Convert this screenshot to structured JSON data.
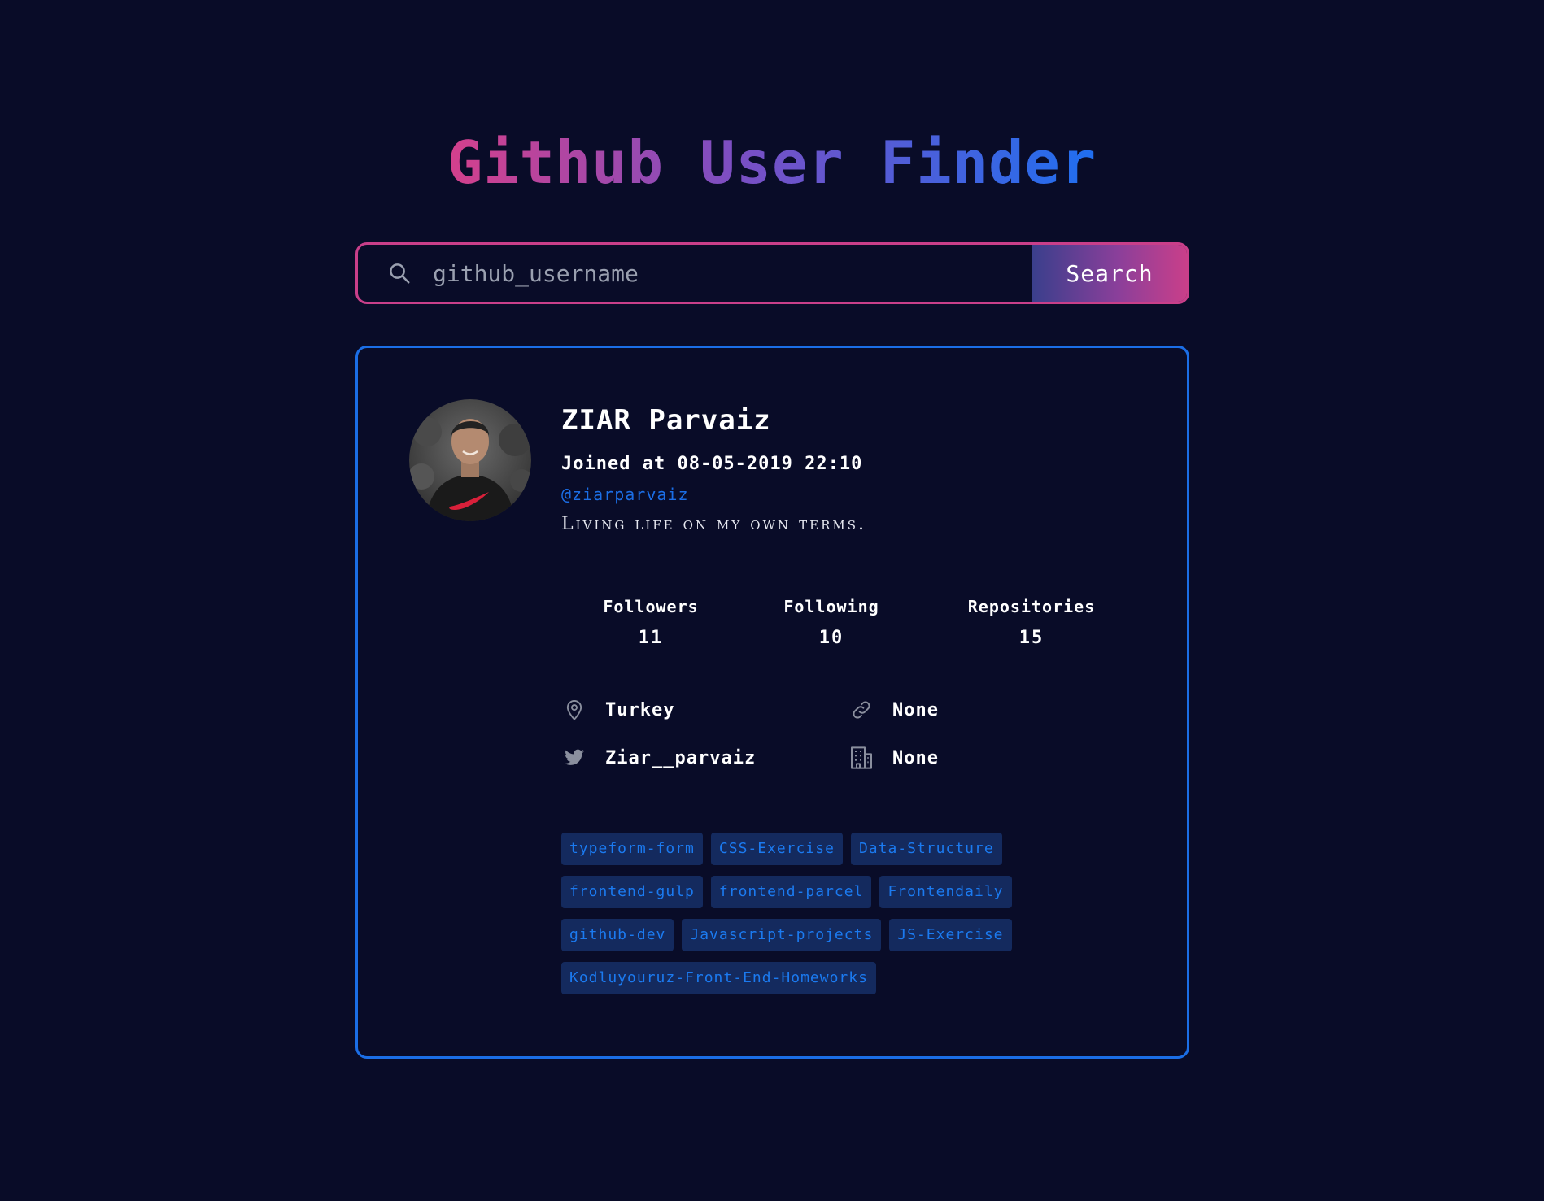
{
  "header": {
    "title": "Github User Finder"
  },
  "search": {
    "placeholder": "github_username",
    "value": "",
    "button_label": "Search"
  },
  "profile": {
    "name": "ZIAR Parvaiz",
    "joined": "Joined at 08-05-2019 22:10",
    "login": "@ziarparvaiz",
    "bio": "Living life on my own terms."
  },
  "stats": {
    "followers_label": "Followers",
    "followers_value": "11",
    "following_label": "Following",
    "following_value": "10",
    "repositories_label": "Repositories",
    "repositories_value": "15"
  },
  "details": {
    "location": "Turkey",
    "blog": "None",
    "twitter": "Ziar__parvaiz",
    "company": "None"
  },
  "repos": [
    "typeform-form",
    "CSS-Exercise",
    "Data-Structure",
    "frontend-gulp",
    "frontend-parcel",
    "Frontendaily",
    "github-dev",
    "Javascript-projects",
    "JS-Exercise",
    "Kodluyouruz-Front-End-Homeworks"
  ],
  "colors": {
    "background": "#090c28",
    "accent_blue": "#1b6ee6",
    "accent_pink": "#c93f8a",
    "tag_background": "#142a5e",
    "tag_text": "#1b7af0"
  },
  "icons": {
    "search": "search-icon",
    "location": "map-pin-icon",
    "blog": "link-icon",
    "twitter": "twitter-icon",
    "company": "building-icon"
  }
}
